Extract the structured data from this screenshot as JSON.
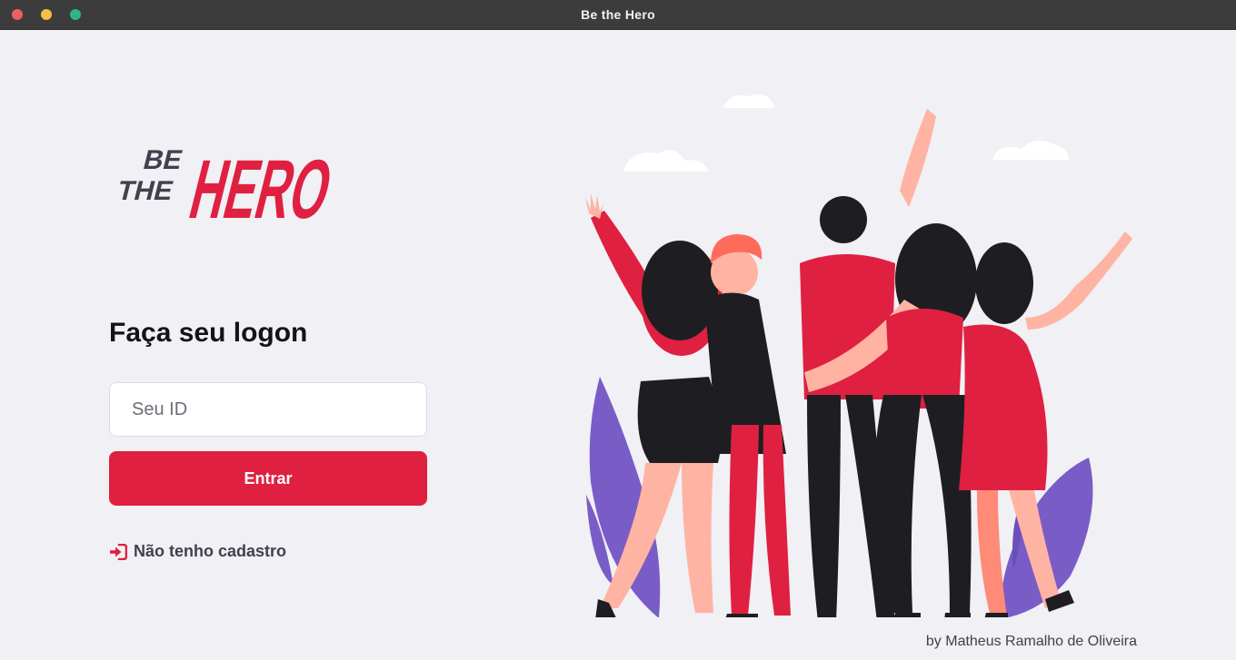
{
  "window": {
    "title": "Be the Hero"
  },
  "logo": {
    "line1": "BE",
    "line2": "THE",
    "word": "HERO"
  },
  "login": {
    "title": "Faça seu logon",
    "id_placeholder": "Seu ID",
    "id_value": "",
    "submit_label": "Entrar",
    "register_label": "Não tenho cadastro",
    "register_icon": "log-in-icon"
  },
  "footer": {
    "credit": "by Matheus Ramalho de Oliveira"
  },
  "colors": {
    "background": "#f0f0f5",
    "brand_red": "#e02041",
    "text_dark": "#13131a",
    "text_gray": "#41414d",
    "titlebar": "#3c3c3c"
  },
  "illustration": {
    "name": "heroes-group-illustration"
  }
}
